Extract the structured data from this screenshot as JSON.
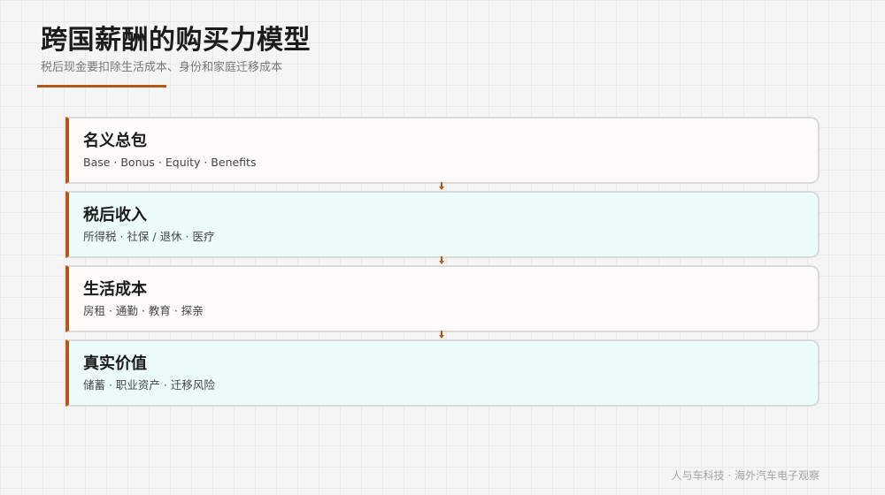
{
  "header": {
    "title": "跨国薪酬的购买力模型",
    "subtitle": "税后现金要扣除生活成本、身份和家庭迁移成本"
  },
  "layers": [
    {
      "title": "名义总包",
      "detail": "Base · Bonus · Equity · Benefits"
    },
    {
      "title": "税后收入",
      "detail": "所得税 · 社保 / 退休 · 医疗"
    },
    {
      "title": "生活成本",
      "detail": "房租 · 通勤 · 教育 · 探亲"
    },
    {
      "title": "真实价值",
      "detail": "储蓄 · 职业资产 · 迁移风险"
    }
  ],
  "footer": {
    "credit": "人与车科技 · 海外汽车电子观察"
  },
  "colors": {
    "accent": "#b5561a",
    "card_light": "#fdfcf8",
    "card_teal": "#ecfcfa"
  }
}
